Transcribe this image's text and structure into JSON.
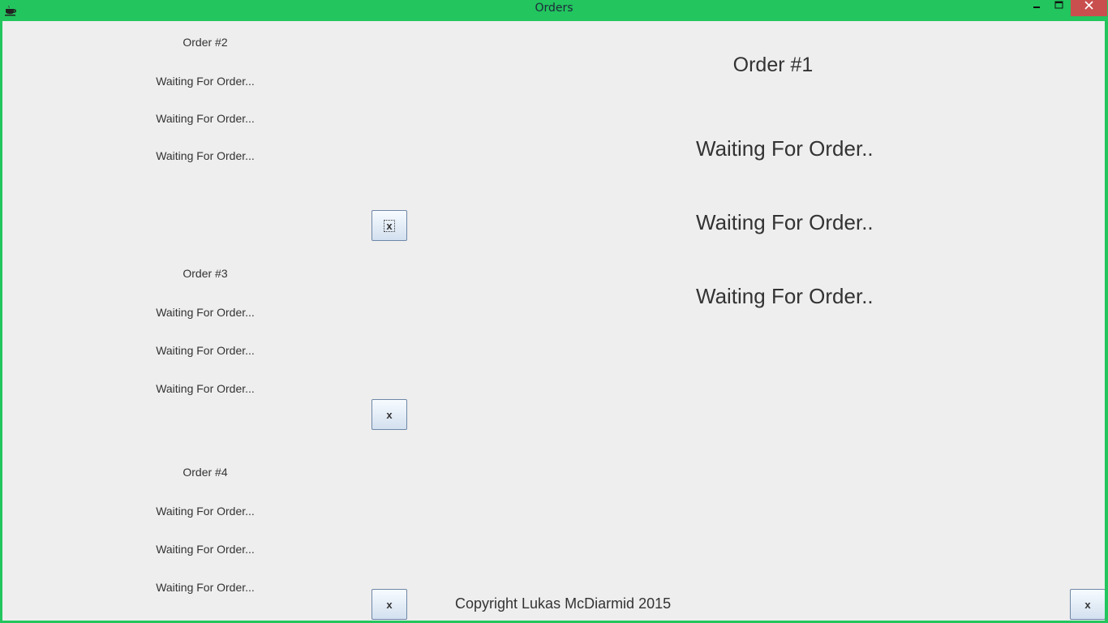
{
  "window": {
    "title": "Orders",
    "minimize_glyph": "–",
    "maximize_glyph": "□",
    "close_glyph": "✕",
    "icon": "java-cup-icon"
  },
  "orders": [
    {
      "title": "Order #2",
      "lines": [
        "Waiting For Order...",
        "Waiting For Order...",
        "Waiting For Order..."
      ],
      "button_label": "x"
    },
    {
      "title": "Order #3",
      "lines": [
        "Waiting For Order...",
        "Waiting For Order...",
        "Waiting For Order..."
      ],
      "button_label": "x"
    },
    {
      "title": "Order #4",
      "lines": [
        "Waiting For Order...",
        "Waiting For Order...",
        "Waiting For Order..."
      ],
      "button_label": "x"
    }
  ],
  "main_order": {
    "title": "Order #1",
    "lines": [
      "Waiting For Order..",
      "Waiting For Order..",
      "Waiting For Order.."
    ],
    "button_label": "x"
  },
  "footer": {
    "copyright": "Copyright Lukas McDiarmid 2015"
  },
  "colors": {
    "title_bar": "#22c55e",
    "close_button": "#c94f4f",
    "client_background": "#eeeeee"
  }
}
